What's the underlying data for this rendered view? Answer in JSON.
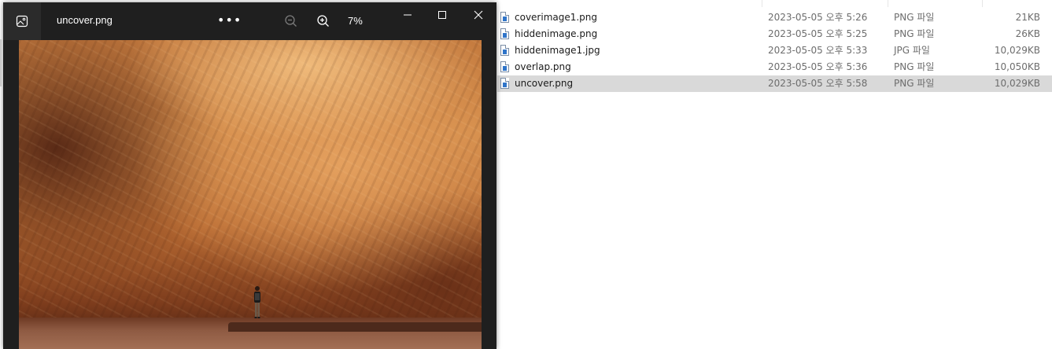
{
  "viewer": {
    "title": "uncover.png",
    "more_label": "•••",
    "zoom_level": "7%"
  },
  "explorer": {
    "files": [
      {
        "name": "coverimage1.png",
        "date": "2023-05-05 오후 5:26",
        "type": "PNG 파일",
        "size": "21KB",
        "selected": false
      },
      {
        "name": "hiddenimage.png",
        "date": "2023-05-05 오후 5:25",
        "type": "PNG 파일",
        "size": "26KB",
        "selected": false
      },
      {
        "name": "hiddenimage1.jpg",
        "date": "2023-05-05 오후 5:33",
        "type": "JPG 파일",
        "size": "10,029KB",
        "selected": false
      },
      {
        "name": "overlap.png",
        "date": "2023-05-05 오후 5:36",
        "type": "PNG 파일",
        "size": "10,050KB",
        "selected": false
      },
      {
        "name": "uncover.png",
        "date": "2023-05-05 오후 5:58",
        "type": "PNG 파일",
        "size": "10,029KB",
        "selected": true
      }
    ]
  },
  "colors": {
    "viewer_bg": "#1f1f1f",
    "selection": "#d9d9d9",
    "file_icon_blue": "#2f74c9"
  },
  "icons": {
    "app": "photos-icon",
    "zoom_out": "zoom-out-icon",
    "zoom_in": "zoom-in-icon",
    "minimize": "minimize-icon",
    "maximize": "maximize-icon",
    "close": "close-icon",
    "file": "image-file-icon"
  }
}
